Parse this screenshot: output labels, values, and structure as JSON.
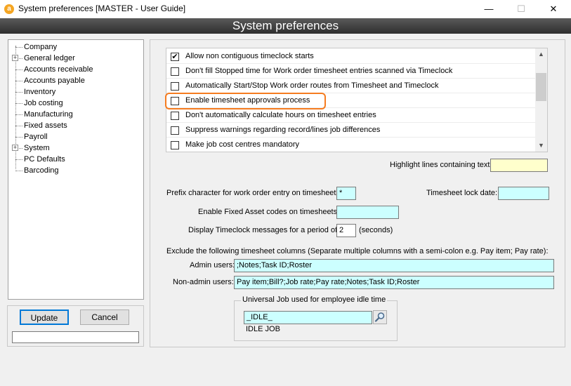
{
  "window": {
    "title": "System preferences [MASTER - User Guide]",
    "app_icon": "a",
    "minimize_glyph": "—",
    "maximize_glyph": "☐",
    "close_glyph": "✕"
  },
  "header": {
    "title": "System preferences"
  },
  "tree": {
    "items": [
      {
        "label": "Company",
        "expandable": false
      },
      {
        "label": "General ledger",
        "expandable": true
      },
      {
        "label": "Accounts receivable",
        "expandable": false
      },
      {
        "label": "Accounts payable",
        "expandable": false
      },
      {
        "label": "Inventory",
        "expandable": false
      },
      {
        "label": "Job costing",
        "expandable": false
      },
      {
        "label": "Manufacturing",
        "expandable": false
      },
      {
        "label": "Fixed assets",
        "expandable": false
      },
      {
        "label": "Payroll",
        "expandable": false
      },
      {
        "label": "System",
        "expandable": true
      },
      {
        "label": "PC Defaults",
        "expandable": false
      },
      {
        "label": "Barcoding",
        "expandable": false
      }
    ],
    "expand_glyph": "+"
  },
  "buttons": {
    "update": "Update",
    "cancel": "Cancel"
  },
  "checklist": {
    "items": [
      {
        "label": "Allow non contiguous timeclock starts",
        "checked": true
      },
      {
        "label": "Don't fill Stopped time for Work order timesheet entries scanned via Timeclock",
        "checked": false
      },
      {
        "label": "Automatically Start/Stop Work order routes from Timesheet and Timeclock",
        "checked": false
      },
      {
        "label": "Enable timesheet approvals process",
        "checked": false
      },
      {
        "label": "Don't automatically calculate hours on timesheet entries",
        "checked": false
      },
      {
        "label": "Suppress warnings regarding record/lines job differences",
        "checked": false
      },
      {
        "label": "Make job cost centres mandatory",
        "checked": false
      }
    ],
    "check_glyph": "✔",
    "highlight_color": "#f57c20"
  },
  "scroll": {
    "up_glyph": "▲",
    "down_glyph": "▼"
  },
  "form": {
    "highlight_label": "Highlight lines containing text:",
    "highlight_value": "",
    "prefix_label": "Prefix character for work order entry on timesheets:",
    "prefix_value": "*",
    "lock_label": "Timesheet lock date:",
    "lock_value": "",
    "fa_label": "Enable Fixed Asset codes on timesheets:",
    "fa_value": "",
    "period_label": "Display Timeclock messages for a period of:",
    "period_value": "2",
    "seconds_label": "(seconds)",
    "exclude_label": "Exclude the following timesheet columns  (Separate multiple columns with a semi-colon e.g. Pay item; Pay rate):",
    "admin_label": "Admin users:",
    "admin_value": ";Notes;Task ID;Roster",
    "nonadmin_label": "Non-admin users:",
    "nonadmin_value": "Pay item;Bill?;Job rate;Pay rate;Notes;Task ID;Roster",
    "idle_group_label": "Universal Job used for employee idle time",
    "idle_value": "_IDLE_",
    "idle_desc": "IDLE JOB"
  }
}
